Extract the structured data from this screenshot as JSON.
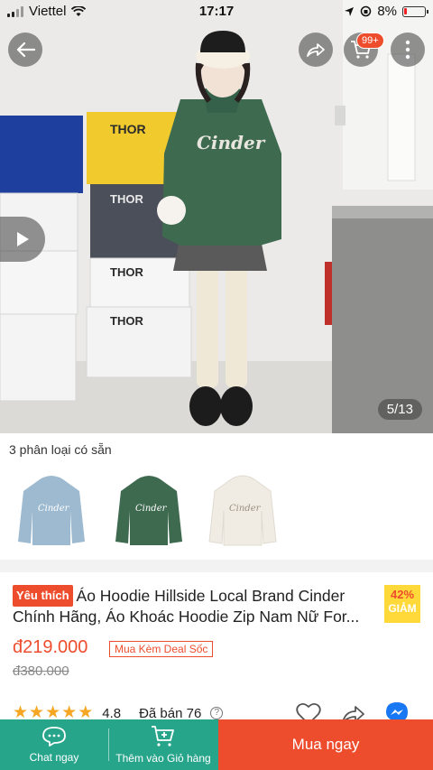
{
  "status_bar": {
    "carrier": "Viettel",
    "time": "17:17",
    "battery": "8%"
  },
  "hero": {
    "image_counter": "5/13",
    "cart_badge": "99+",
    "box_brand": "THOR",
    "hoodie_print": "Cinder"
  },
  "variants": {
    "title": "3 phân loại có sẵn",
    "items": [
      {
        "color": "#9dbad0",
        "print": "Cinder"
      },
      {
        "color": "#3e6a50",
        "print": "Cinder"
      },
      {
        "color": "#f0ece4",
        "print": "Cinder"
      }
    ]
  },
  "product": {
    "favorite_badge": "Yêu thích",
    "title": "Áo Hoodie Hillside Local Brand Cinder Chính Hãng, Áo Khoác Hoodie Zip Nam Nữ For...",
    "discount_percent": "42%",
    "discount_label": "GIẢM",
    "price": "đ219.000",
    "deal_tag": "Mua Kèm Deal Sốc",
    "old_price": "đ380.000",
    "rating": "4.8",
    "rating_value": 4.8,
    "sold": "Đã bán 76"
  },
  "bottom_bar": {
    "chat_label": "Chat ngay",
    "add_cart_label": "Thêm vào Giỏ hàng",
    "buy_label": "Mua ngay"
  },
  "colors": {
    "accent": "#ee4d2d",
    "bottom_green": "#27a58b",
    "star": "#f5a623"
  }
}
